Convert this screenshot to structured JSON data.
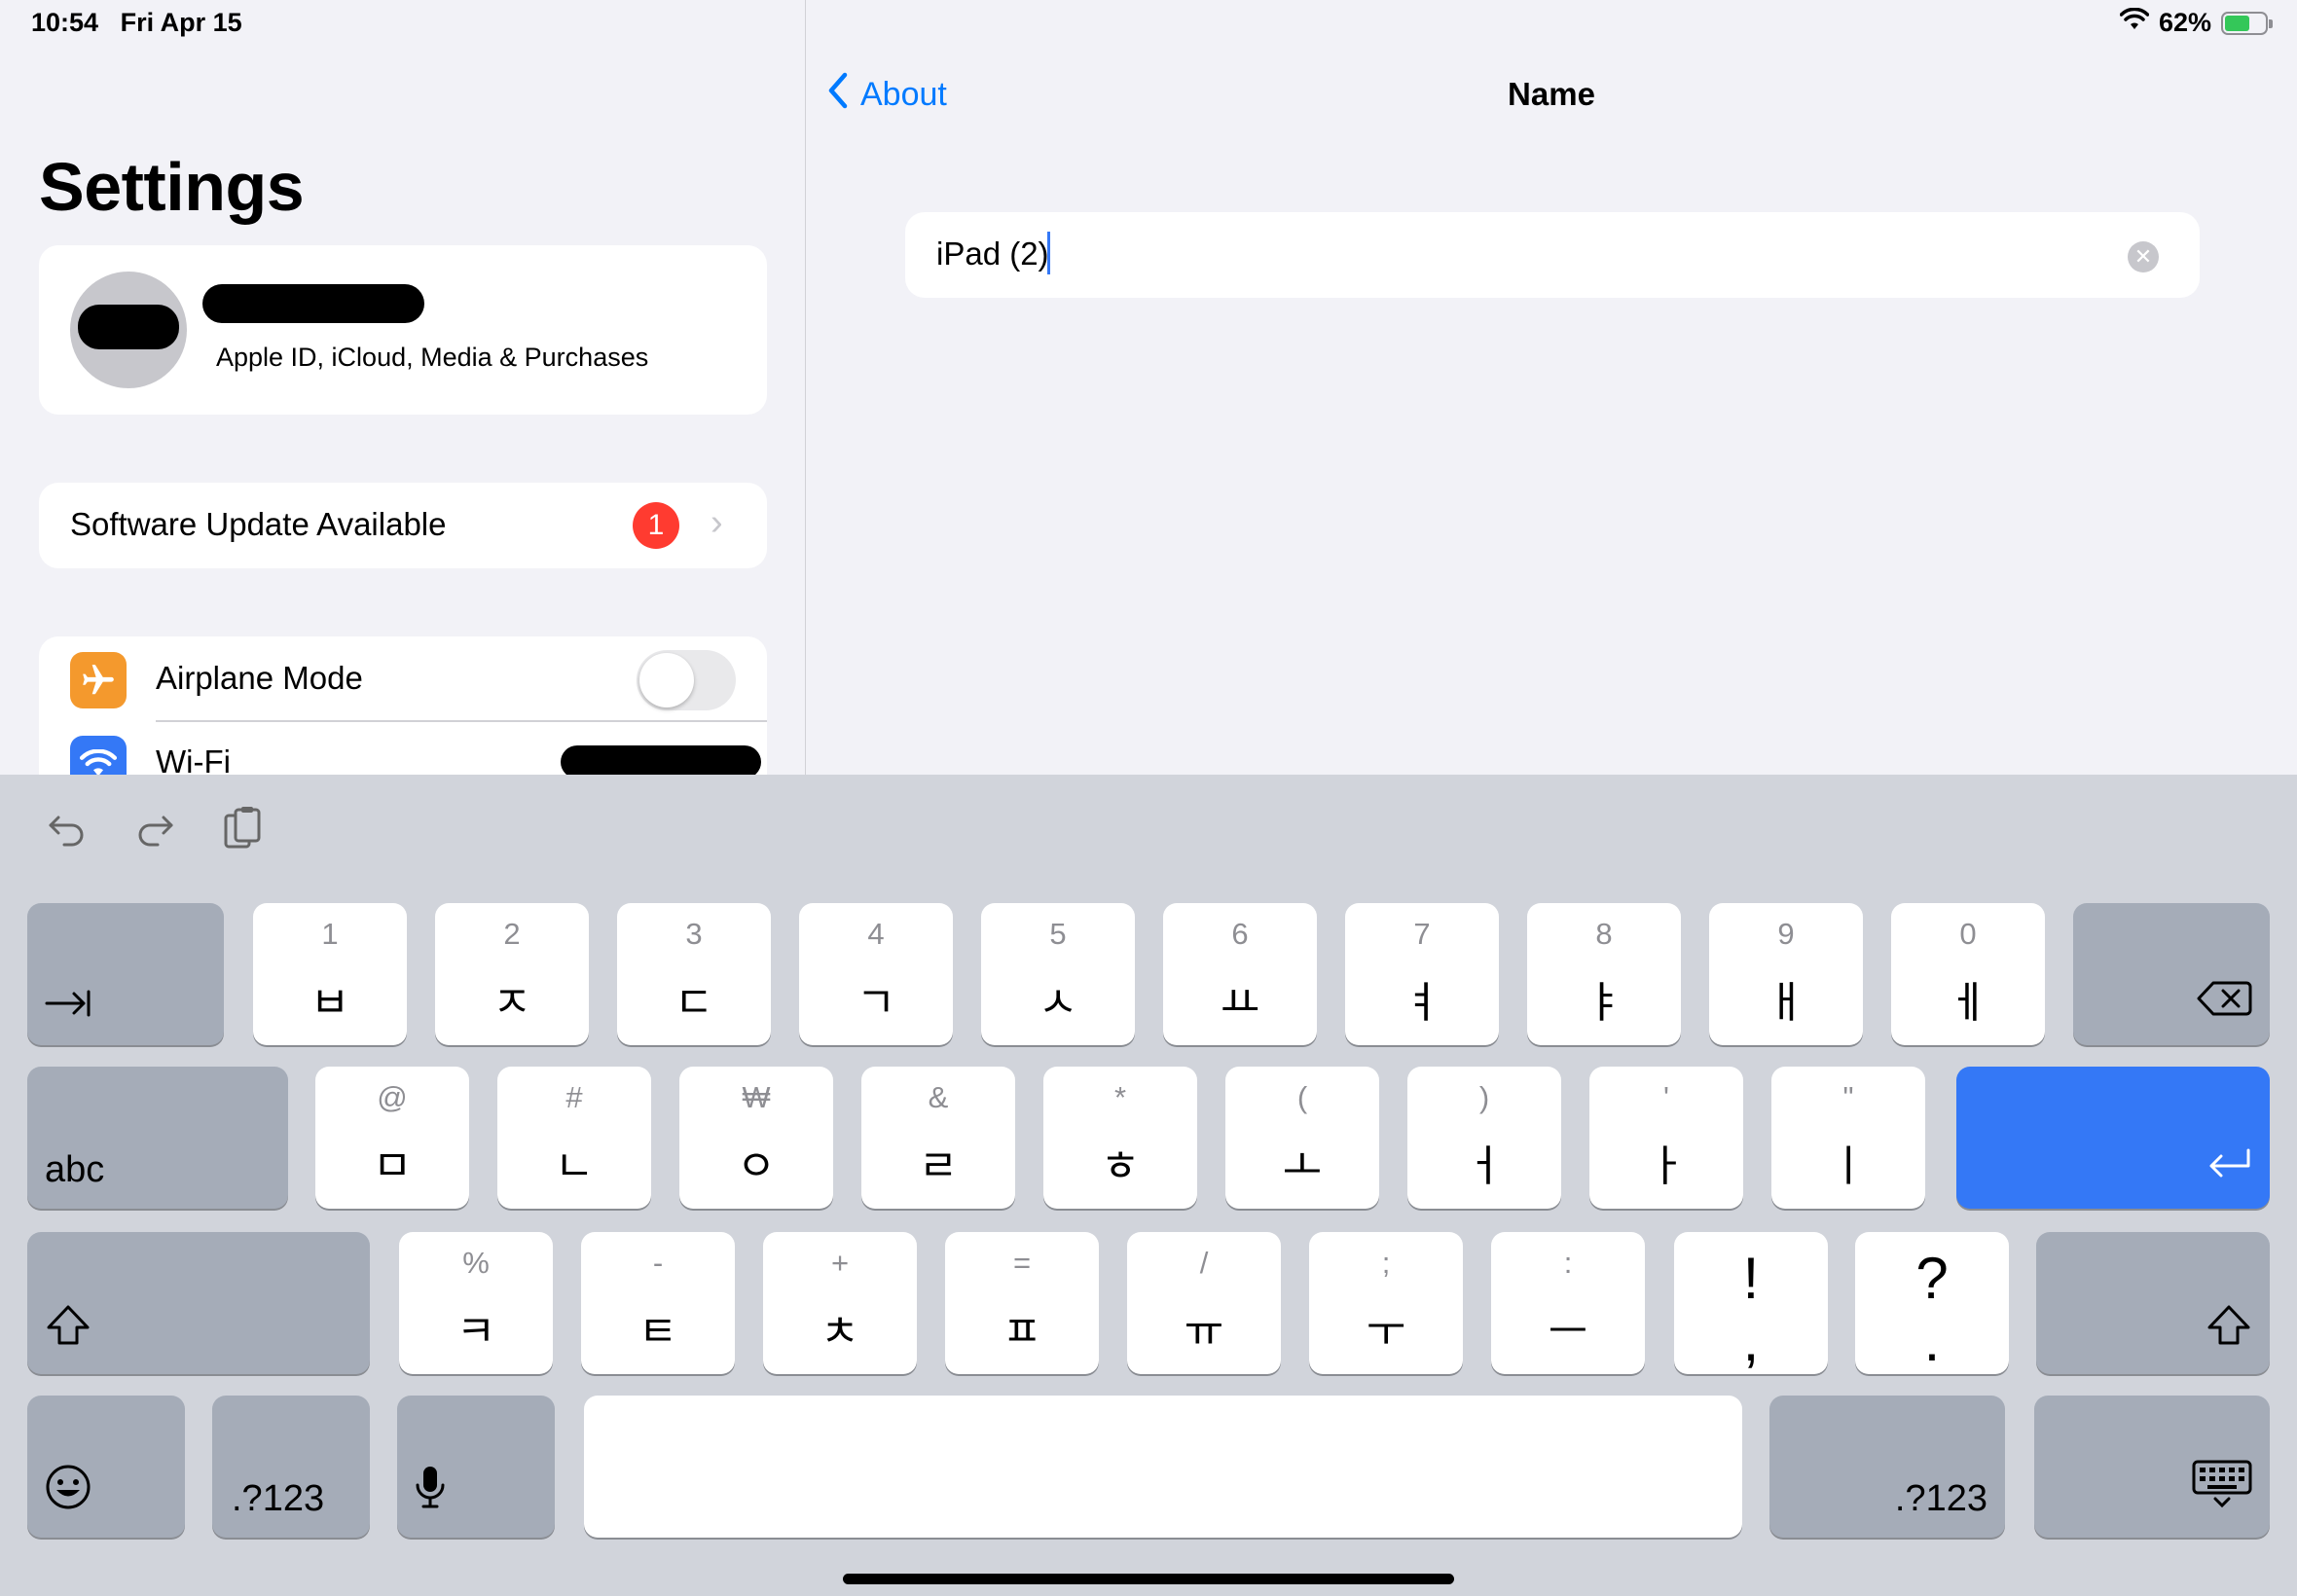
{
  "status": {
    "time": "10:54",
    "date": "Fri Apr 15",
    "battery": "62%",
    "battery_level": 0.62
  },
  "sidebar": {
    "title": "Settings",
    "profile_subtitle": "Apple ID, iCloud, Media & Purchases",
    "update_label": "Software Update Available",
    "update_badge": "1",
    "rows": [
      {
        "label": "Airplane Mode",
        "icon": "airplane-icon",
        "color": "#f4992d"
      },
      {
        "label": "Wi-Fi",
        "icon": "wifi-icon",
        "color": "#3478f6"
      }
    ]
  },
  "nav": {
    "back_label": "About",
    "title": "Name"
  },
  "field": {
    "value": "iPad (2)"
  },
  "keyboard": {
    "row1": [
      {
        "hint": "1",
        "main": "ㅂ"
      },
      {
        "hint": "2",
        "main": "ㅈ"
      },
      {
        "hint": "3",
        "main": "ㄷ"
      },
      {
        "hint": "4",
        "main": "ㄱ"
      },
      {
        "hint": "5",
        "main": "ㅅ"
      },
      {
        "hint": "6",
        "main": "ㅛ"
      },
      {
        "hint": "7",
        "main": "ㅕ"
      },
      {
        "hint": "8",
        "main": "ㅑ"
      },
      {
        "hint": "9",
        "main": "ㅐ"
      },
      {
        "hint": "0",
        "main": "ㅔ"
      }
    ],
    "row2": [
      {
        "hint": "@",
        "main": "ㅁ"
      },
      {
        "hint": "#",
        "main": "ㄴ"
      },
      {
        "hint": "₩",
        "main": "ㅇ"
      },
      {
        "hint": "&",
        "main": "ㄹ"
      },
      {
        "hint": "*",
        "main": "ㅎ"
      },
      {
        "hint": "(",
        "main": "ㅗ"
      },
      {
        "hint": ")",
        "main": "ㅓ"
      },
      {
        "hint": "'",
        "main": "ㅏ"
      },
      {
        "hint": "\"",
        "main": "ㅣ"
      }
    ],
    "row3": [
      {
        "hint": "%",
        "main": "ㅋ"
      },
      {
        "hint": "-",
        "main": "ㅌ"
      },
      {
        "hint": "+",
        "main": "ㅊ"
      },
      {
        "hint": "=",
        "main": "ㅍ"
      },
      {
        "hint": "/",
        "main": "ㅠ"
      },
      {
        "hint": ";",
        "main": "ㅜ"
      },
      {
        "hint": ":",
        "main": "ㅡ"
      }
    ],
    "punct": [
      {
        "main": "!\n,"
      },
      {
        "main": "?\n."
      }
    ],
    "abc_label": "abc",
    "numbers_label": ".?123"
  }
}
